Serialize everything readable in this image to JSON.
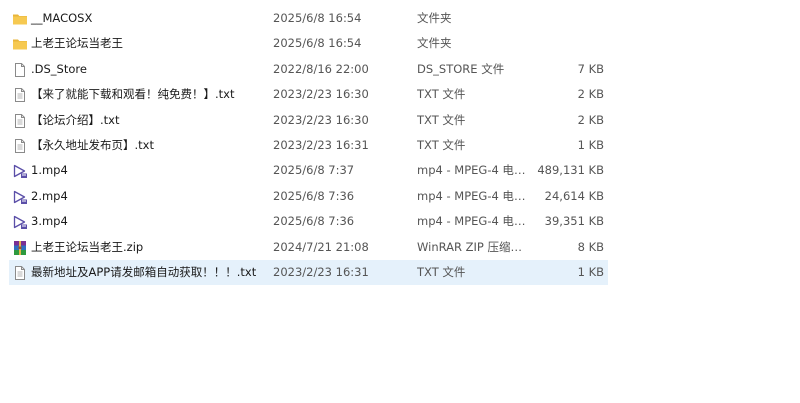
{
  "files": [
    {
      "name": "__MACOSX",
      "date": "2025/6/8 16:54",
      "type": "文件夹",
      "size": "",
      "icon": "folder-icon",
      "selected": false
    },
    {
      "name": "上老王论坛当老王",
      "date": "2025/6/8 16:54",
      "type": "文件夹",
      "size": "",
      "icon": "folder-icon",
      "selected": false
    },
    {
      "name": ".DS_Store",
      "date": "2022/8/16 22:00",
      "type": "DS_STORE 文件",
      "size": "7 KB",
      "icon": "file-icon",
      "selected": false
    },
    {
      "name": "【来了就能下载和观看！纯免费！】.txt",
      "date": "2023/2/23 16:30",
      "type": "TXT 文件",
      "size": "2 KB",
      "icon": "text-file-icon",
      "selected": false
    },
    {
      "name": "【论坛介绍】.txt",
      "date": "2023/2/23 16:30",
      "type": "TXT 文件",
      "size": "2 KB",
      "icon": "text-file-icon",
      "selected": false
    },
    {
      "name": "【永久地址发布页】.txt",
      "date": "2023/2/23 16:31",
      "type": "TXT 文件",
      "size": "1 KB",
      "icon": "text-file-icon",
      "selected": false
    },
    {
      "name": "1.mp4",
      "date": "2025/6/8 7:37",
      "type": "mp4 - MPEG-4 电影...",
      "size": "489,131 KB",
      "icon": "video-file-icon",
      "selected": false
    },
    {
      "name": "2.mp4",
      "date": "2025/6/8 7:36",
      "type": "mp4 - MPEG-4 电影...",
      "size": "24,614 KB",
      "icon": "video-file-icon",
      "selected": false
    },
    {
      "name": "3.mp4",
      "date": "2025/6/8 7:36",
      "type": "mp4 - MPEG-4 电影...",
      "size": "39,351 KB",
      "icon": "video-file-icon",
      "selected": false
    },
    {
      "name": "上老王论坛当老王.zip",
      "date": "2024/7/21 21:08",
      "type": "WinRAR ZIP 压缩文件",
      "size": "8 KB",
      "icon": "winrar-archive-icon",
      "selected": false
    },
    {
      "name": "最新地址及APP请发邮箱自动获取！！！.txt",
      "date": "2023/2/23 16:31",
      "type": "TXT 文件",
      "size": "1 KB",
      "icon": "text-file-icon",
      "selected": true
    }
  ],
  "colors": {
    "folder": "#f4c247",
    "selection": "#e5f1fb",
    "video_accent": "#6b4fbb"
  }
}
